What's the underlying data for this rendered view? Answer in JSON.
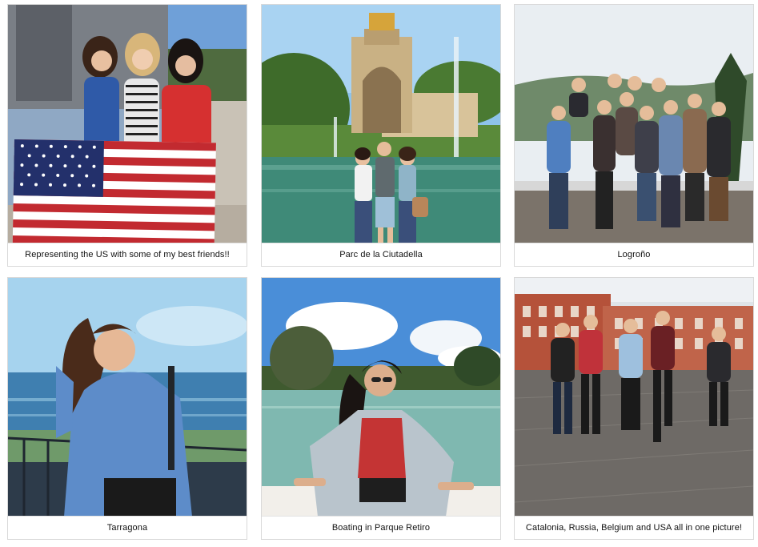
{
  "gallery": {
    "cards": [
      {
        "caption": "Representing the US with some of my best friends!!"
      },
      {
        "caption": "Parc de la Ciutadella"
      },
      {
        "caption": "Logroño"
      },
      {
        "caption": "Tarragona"
      },
      {
        "caption": "Boating in Parque Retiro"
      },
      {
        "caption": "Catalonia, Russia, Belgium and USA all in one picture!"
      }
    ]
  }
}
